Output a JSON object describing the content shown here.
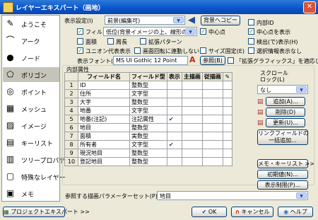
{
  "window": {
    "title": "レイヤーエキスパート（画地）",
    "close_glyph": "✕"
  },
  "sidebar": {
    "items": [
      {
        "label": "ようこそ",
        "icon": "compass-icon",
        "glyph": "✎"
      },
      {
        "label": "アーク",
        "icon": "arc-icon",
        "glyph": "⌒"
      },
      {
        "label": "ノード",
        "icon": "node-icon",
        "glyph": "●"
      },
      {
        "label": "ポリゴン",
        "icon": "polygon-icon",
        "glyph": "⬠",
        "selected": true
      },
      {
        "label": "ポイント",
        "icon": "point-icon",
        "glyph": "◎"
      },
      {
        "label": "メッシュ",
        "icon": "mesh-icon",
        "glyph": "▦"
      },
      {
        "label": "イメージ",
        "icon": "image-icon",
        "glyph": "▨"
      },
      {
        "label": "キーリスト",
        "icon": "keylist-icon",
        "glyph": "▤"
      },
      {
        "label": "ツリープロパティ",
        "icon": "tree-icon",
        "glyph": "▥"
      },
      {
        "label": "特殊なレイヤー",
        "icon": "special-layer-icon",
        "glyph": "▢"
      },
      {
        "label": "メモ",
        "icon": "memo-icon",
        "glyph": "▣"
      }
    ]
  },
  "display": {
    "setting_label": "表示設定(I)",
    "setting_value": "前景(編集可)",
    "back_button": "背景へコピー",
    "fill_label": "フィル",
    "fill_value": "低位(背景イメージの上、線形の下)",
    "center_point_label": "中心点",
    "area_label": "面積",
    "perimeter_label": "周長",
    "pattern_label": "拡張パターン",
    "unicorn_label": "ユニオン代表表示",
    "rotate_label": "画面回転に連動しない",
    "size_fixed_label": "サイズ固定(E)",
    "font_label": "表示フォント(E)",
    "font_value": "MS UI Gothic 12 Point",
    "ref_button": "参照(B)",
    "ext_graphics_label": "「拡張グラフィックス」を適応しない"
  },
  "right_options": {
    "inner_id": "内部ID",
    "center_show": "中心点を表示",
    "hatch_show": "検出(で)表示(H)",
    "selected_show": "選択情報表示なし"
  },
  "attributes": {
    "group_label": "内部属性",
    "headers": [
      "",
      "フィールド名",
      "フィールド型",
      "表示",
      "主描画",
      "従描画",
      ""
    ],
    "rows": [
      {
        "n": "1",
        "name": "ID",
        "type": "整数型",
        "show": "",
        "main": "",
        "sub": "",
        "edit": ""
      },
      {
        "n": "2",
        "name": "住所",
        "type": "文字型",
        "show": "",
        "main": "",
        "sub": "",
        "edit": ""
      },
      {
        "n": "3",
        "name": "大字",
        "type": "整数型",
        "show": "",
        "main": "",
        "sub": "",
        "edit": ""
      },
      {
        "n": "4",
        "name": "地番",
        "type": "文字型",
        "show": "",
        "main": "",
        "sub": "",
        "edit": ""
      },
      {
        "n": "5",
        "name": "地番(注記)",
        "type": "注記属性",
        "show": "✔",
        "main": "",
        "sub": "",
        "edit": ""
      },
      {
        "n": "6",
        "name": "地目",
        "type": "整数型",
        "show": "",
        "main": "",
        "sub": "",
        "edit": ""
      },
      {
        "n": "7",
        "name": "面積",
        "type": "実数型",
        "show": "",
        "main": "",
        "sub": "",
        "edit": ""
      },
      {
        "n": "8",
        "name": "所有者",
        "type": "文字型",
        "show": "✔",
        "main": "",
        "sub": "",
        "edit": ""
      },
      {
        "n": "9",
        "name": "現況地目",
        "type": "整数型",
        "show": "",
        "main": "",
        "sub": "",
        "edit": ""
      },
      {
        "n": "10",
        "name": "登記地目",
        "type": "整数型",
        "show": "",
        "main": "",
        "sub": "",
        "edit": ""
      }
    ]
  },
  "scroll": {
    "label": "スクロール\nロック(L)",
    "value": "なし",
    "add": "追加(A)...",
    "delete": "削除(D)",
    "update": "更新(U)...",
    "link": "リンクフィールドの\n一括追加..."
  },
  "memo_buttons": {
    "memo_keylist": "メモ・キーリスト >>",
    "init_setting": "初期値(N)...",
    "display_limit": "表示制限(P)..."
  },
  "param_set": {
    "label": "参照する描画パラメーターセット(P)",
    "value": "地目"
  },
  "footer": {
    "project_expert": "プロジェクトエキスパート >>",
    "ok": "OK",
    "cancel": "キャンセル",
    "help": "ヘルプ"
  }
}
